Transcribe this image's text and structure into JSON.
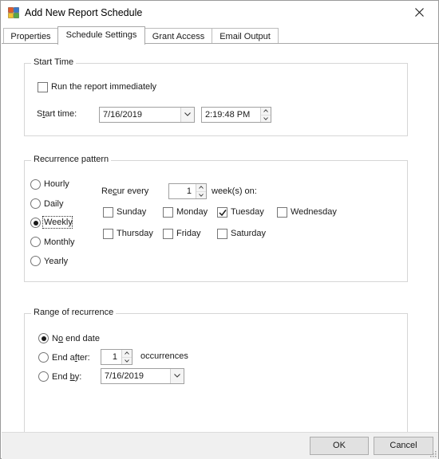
{
  "window": {
    "title": "Add New Report Schedule"
  },
  "tabs": [
    {
      "label": "Properties"
    },
    {
      "label": "Schedule Settings",
      "active": true
    },
    {
      "label": "Grant Access"
    },
    {
      "label": "Email Output"
    }
  ],
  "start_time": {
    "group_title": "Start Time",
    "run_immediately_label": "Run the report immediately",
    "run_immediately_checked": false,
    "start_time_label_pre": "S",
    "start_time_label_u": "t",
    "start_time_label_post": "art time:",
    "date_value": "7/16/2019",
    "time_value": "2:19:48 PM"
  },
  "recurrence": {
    "group_title": "Recurrence pattern",
    "options": [
      {
        "label": "Hourly",
        "selected": false
      },
      {
        "label": "Daily",
        "selected": false
      },
      {
        "label": "Weekly",
        "selected": true
      },
      {
        "label": "Monthly",
        "selected": false
      },
      {
        "label": "Yearly",
        "selected": false
      }
    ],
    "recur_every_pre": "Re",
    "recur_every_u": "c",
    "recur_every_post": "ur every",
    "recur_every_value": "1",
    "weeks_on_label": "week(s) on:",
    "days": [
      {
        "label": "Sunday",
        "checked": false
      },
      {
        "label": "Monday",
        "checked": false
      },
      {
        "label": "Tuesday",
        "checked": true
      },
      {
        "label": "Wednesday",
        "checked": false
      },
      {
        "label": "Thursday",
        "checked": false
      },
      {
        "label": "Friday",
        "checked": false
      },
      {
        "label": "Saturday",
        "checked": false
      }
    ]
  },
  "range": {
    "group_title": "Range of recurrence",
    "no_end_pre": "N",
    "no_end_u": "o",
    "no_end_post": " end date",
    "no_end_selected": true,
    "end_after_pre": "End a",
    "end_after_u": "f",
    "end_after_post": "ter:",
    "end_after_value": "1",
    "occurrences_label": "occurrences",
    "end_by_pre": "End ",
    "end_by_u": "b",
    "end_by_post": "y:",
    "end_by_value": "7/16/2019"
  },
  "footer": {
    "ok_label": "OK",
    "cancel_label": "Cancel"
  }
}
